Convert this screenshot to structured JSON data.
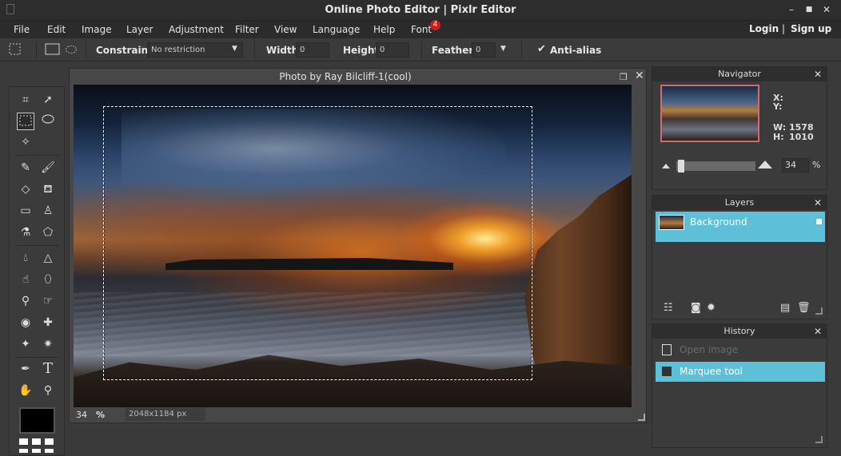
{
  "window": {
    "title": "Online Photo Editor | Pixlr Editor",
    "minimize": "–",
    "maximize": "■",
    "close": "✕"
  },
  "menu": {
    "items": [
      "File",
      "Edit",
      "Image",
      "Layer",
      "Adjustment",
      "Filter",
      "View",
      "Language",
      "Help",
      "Font"
    ],
    "font_badge": "4",
    "login": "Login",
    "separator": "|",
    "signup": "Sign up"
  },
  "options": {
    "constraint_label": "Constraint:",
    "constraint_value": "No restriction",
    "width_label": "Width:",
    "width_value": "0",
    "height_label": "Height:",
    "height_value": "0",
    "feather_label": "Feather:",
    "feather_value": "0",
    "antialias_label": "Anti-alias",
    "antialias_checked": true
  },
  "document": {
    "title": "Photo by Ray Bilcliff-1(cool)",
    "zoom": "34",
    "zoom_unit": "%",
    "size": "2048x1184 px"
  },
  "navigator": {
    "title": "Navigator",
    "x_label": "X:",
    "y_label": "Y:",
    "w_label": "W:",
    "w_value": "1578",
    "h_label": "H:",
    "h_value": "1010",
    "zoom": "34",
    "zoom_unit": "%",
    "zoom_fraction": 0.02
  },
  "layers": {
    "title": "Layers",
    "items": [
      {
        "name": "Background",
        "locked": true,
        "selected": true
      }
    ]
  },
  "history": {
    "title": "History",
    "items": [
      {
        "label": "Open image",
        "selected": false
      },
      {
        "label": "Marquee tool",
        "selected": true
      }
    ]
  },
  "colors": {
    "accent": "#5ebfd8",
    "foreground": "#000000",
    "background": "#ffffff",
    "badge": "#c62020",
    "nav_border": "#d06b6b"
  }
}
